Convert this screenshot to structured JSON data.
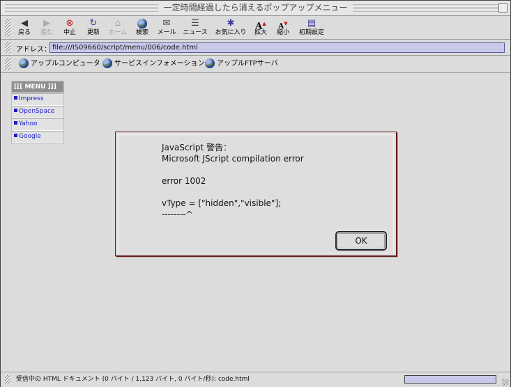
{
  "window": {
    "title": "一定時間経過したら消えるポップアップメニュー"
  },
  "toolbar": {
    "buttons": [
      {
        "label": "戻る",
        "icon": "back-arrow-icon",
        "glyph": "◆"
      },
      {
        "label": "進む",
        "icon": "forward-arrow-icon",
        "glyph": "◆"
      },
      {
        "label": "中止",
        "icon": "stop-icon",
        "glyph": "✖"
      },
      {
        "label": "更新",
        "icon": "refresh-icon",
        "glyph": "↻"
      },
      {
        "label": "ホーム",
        "icon": "home-icon",
        "glyph": "⌂"
      },
      {
        "label": "検索",
        "icon": "search-globe-icon",
        "glyph": "●"
      },
      {
        "label": "メール",
        "icon": "mail-icon",
        "glyph": "✉"
      },
      {
        "label": "ニュース",
        "icon": "news-icon",
        "glyph": "☰"
      },
      {
        "label": "お気に入り",
        "icon": "favorites-icon",
        "glyph": "✱"
      },
      {
        "label": "拡大",
        "icon": "zoom-in-icon",
        "glyph": "A"
      },
      {
        "label": "縮小",
        "icon": "zoom-out-icon",
        "glyph": "A"
      },
      {
        "label": "初期設定",
        "icon": "preferences-icon",
        "glyph": "▤"
      }
    ]
  },
  "address": {
    "label": "アドレス：",
    "value": "file:///IS09660/script/menu/006/code.html"
  },
  "favorites": [
    {
      "label": "アップルコンピュータ"
    },
    {
      "label": "サービスインフォメーション"
    },
    {
      "label": "アップルFTPサーバ"
    }
  ],
  "menu": {
    "header": "[[[ MENU ]]]",
    "items": [
      {
        "label": "Impress"
      },
      {
        "label": "OpenSpace"
      },
      {
        "label": "Yahoo"
      },
      {
        "label": "Google"
      }
    ]
  },
  "dialog": {
    "text": "JavaScript 警告：\nMicrosoft JScript compilation error\n\nerror 1002\n\nvType = [\"hidden\",\"visible\"];\n--------^",
    "ok_label": "OK"
  },
  "status": {
    "text": "受信中の HTML ドキュメント (0 バイト / 1,123 バイト, 0 バイト/秒): code.html"
  },
  "colors": {
    "address_field": "#c9c9ea",
    "link": "#1a1acc",
    "dialog_border": "#6a1a1a"
  }
}
